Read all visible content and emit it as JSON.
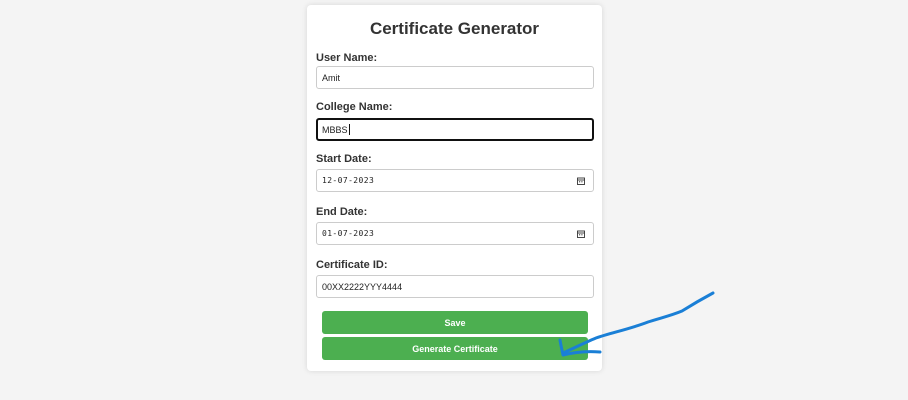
{
  "form": {
    "title": "Certificate Generator",
    "user_name_label": "User Name:",
    "user_name_value": "Amit",
    "college_name_label": "College Name:",
    "college_name_value": "MBBS",
    "start_date_label": "Start Date:",
    "start_date_value": "12-07-2023",
    "end_date_label": "End Date:",
    "end_date_value": "01-07-2023",
    "certificate_id_label": "Certificate ID:",
    "certificate_id_value": "00XX2222YYY4444",
    "save_label": "Save",
    "generate_label": "Generate Certificate"
  },
  "icons": {
    "date_picker": "calendar-icon",
    "annotation": "hand-drawn-arrow"
  },
  "colors": {
    "button": "#4caf50",
    "annotation_arrow": "#1a7fd6",
    "page_background": "#f4f4f4"
  }
}
